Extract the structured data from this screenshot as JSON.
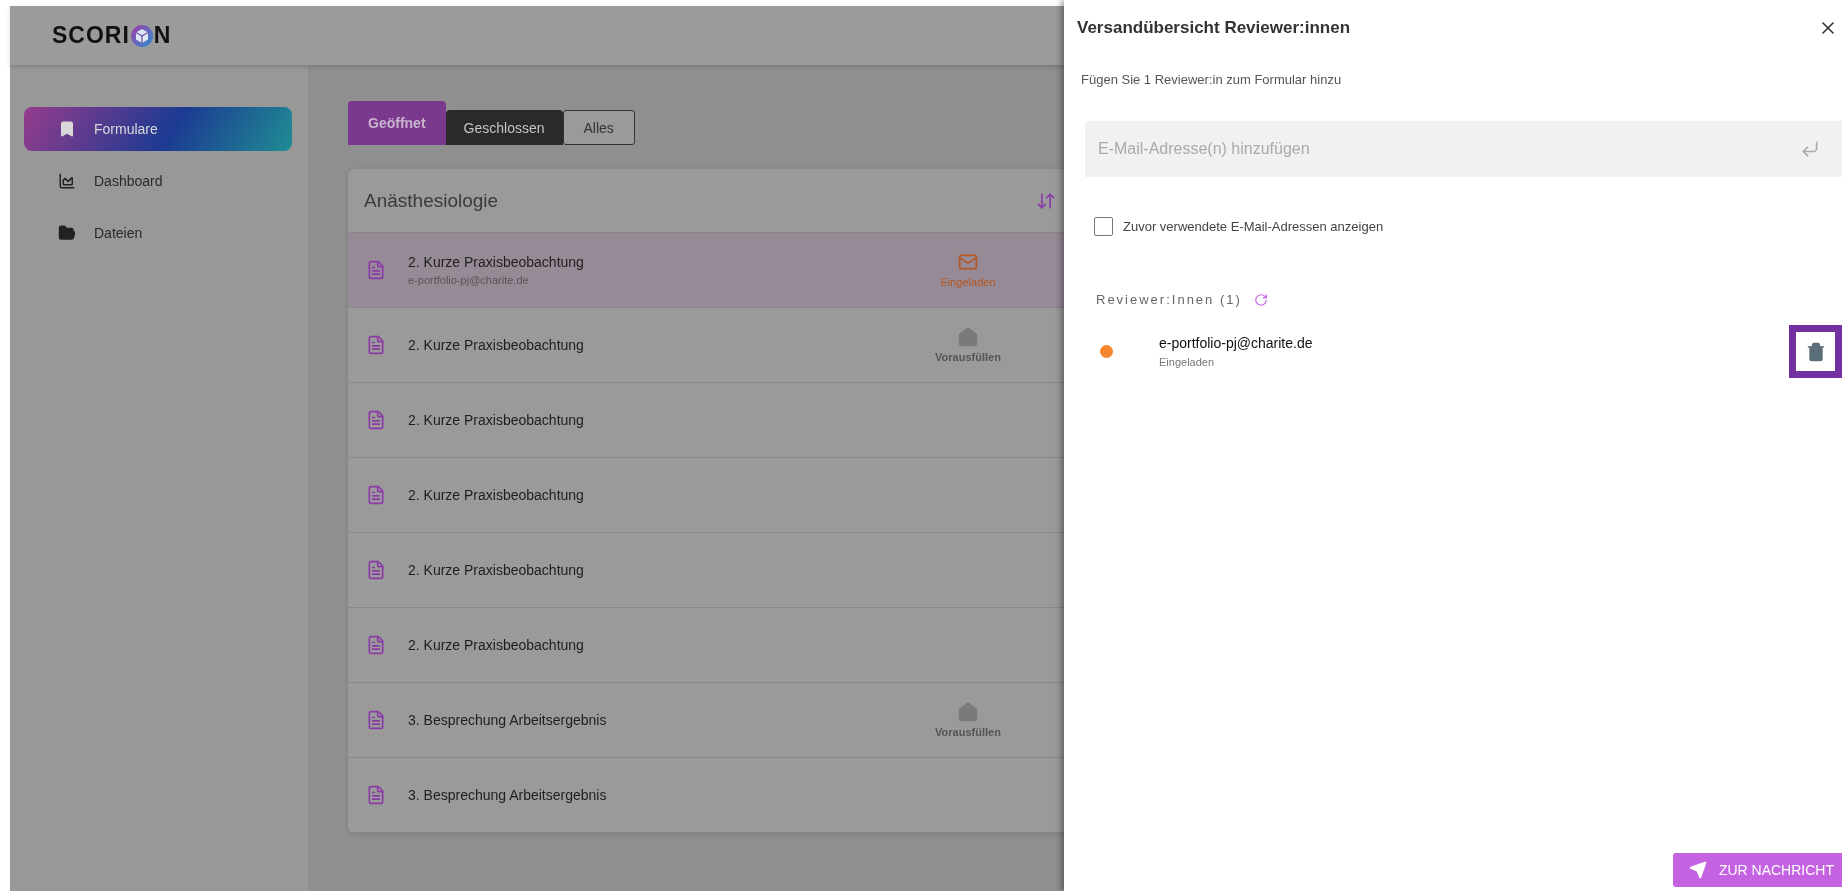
{
  "logo": {
    "before": "SCORI",
    "after": "N"
  },
  "sidebar": {
    "items": [
      {
        "label": "Formulare",
        "kind": "forms",
        "selected": true
      },
      {
        "label": "Dashboard",
        "kind": "chart",
        "selected": false
      },
      {
        "label": "Dateien",
        "kind": "folder",
        "selected": false
      }
    ]
  },
  "tabs": [
    {
      "label": "Geöffnet",
      "selected": true
    },
    {
      "label": "Geschlossen",
      "selected": false
    },
    {
      "label": "Alles",
      "selected": false
    }
  ],
  "card": {
    "title": "Anästhesiologie",
    "rows": [
      {
        "title": "2. Kurze Praxisbeobachtung",
        "subtitle": "e-portfolio-pj@charite.de",
        "selected": true,
        "status": {
          "kind": "invited",
          "label": "Eingeladen"
        }
      },
      {
        "title": "2. Kurze Praxisbeobachtung",
        "selected": false,
        "status": {
          "kind": "prefill",
          "label": "Vorausfüllen"
        }
      },
      {
        "title": "2. Kurze Praxisbeobachtung",
        "selected": false
      },
      {
        "title": "2. Kurze Praxisbeobachtung",
        "selected": false
      },
      {
        "title": "2. Kurze Praxisbeobachtung",
        "selected": false
      },
      {
        "title": "2. Kurze Praxisbeobachtung",
        "selected": false
      },
      {
        "title": "3. Besprechung Arbeitsergebnis",
        "selected": false,
        "status": {
          "kind": "prefill",
          "label": "Vorausfüllen"
        }
      },
      {
        "title": "3. Besprechung Arbeitsergebnis",
        "selected": false
      }
    ]
  },
  "panel": {
    "title": "Versandübersicht Reviewer:innen",
    "hint": "Fügen Sie 1 Reviewer:in zum Formular hinzu",
    "email_field": {
      "placeholder": "E-Mail-Adresse(n) hinzufügen"
    },
    "show_previous": {
      "label": "Zuvor verwendete E-Mail-Adressen anzeigen",
      "checked": false
    },
    "reviewers_heading": "Reviewer:Innen (1)",
    "reviewers": [
      {
        "email": "e-portfolio-pj@charite.de",
        "status": "Eingeladen",
        "color": "#f5862e",
        "delete_highlighted": true
      }
    ],
    "send_button": "ZUR NACHRICHT"
  }
}
